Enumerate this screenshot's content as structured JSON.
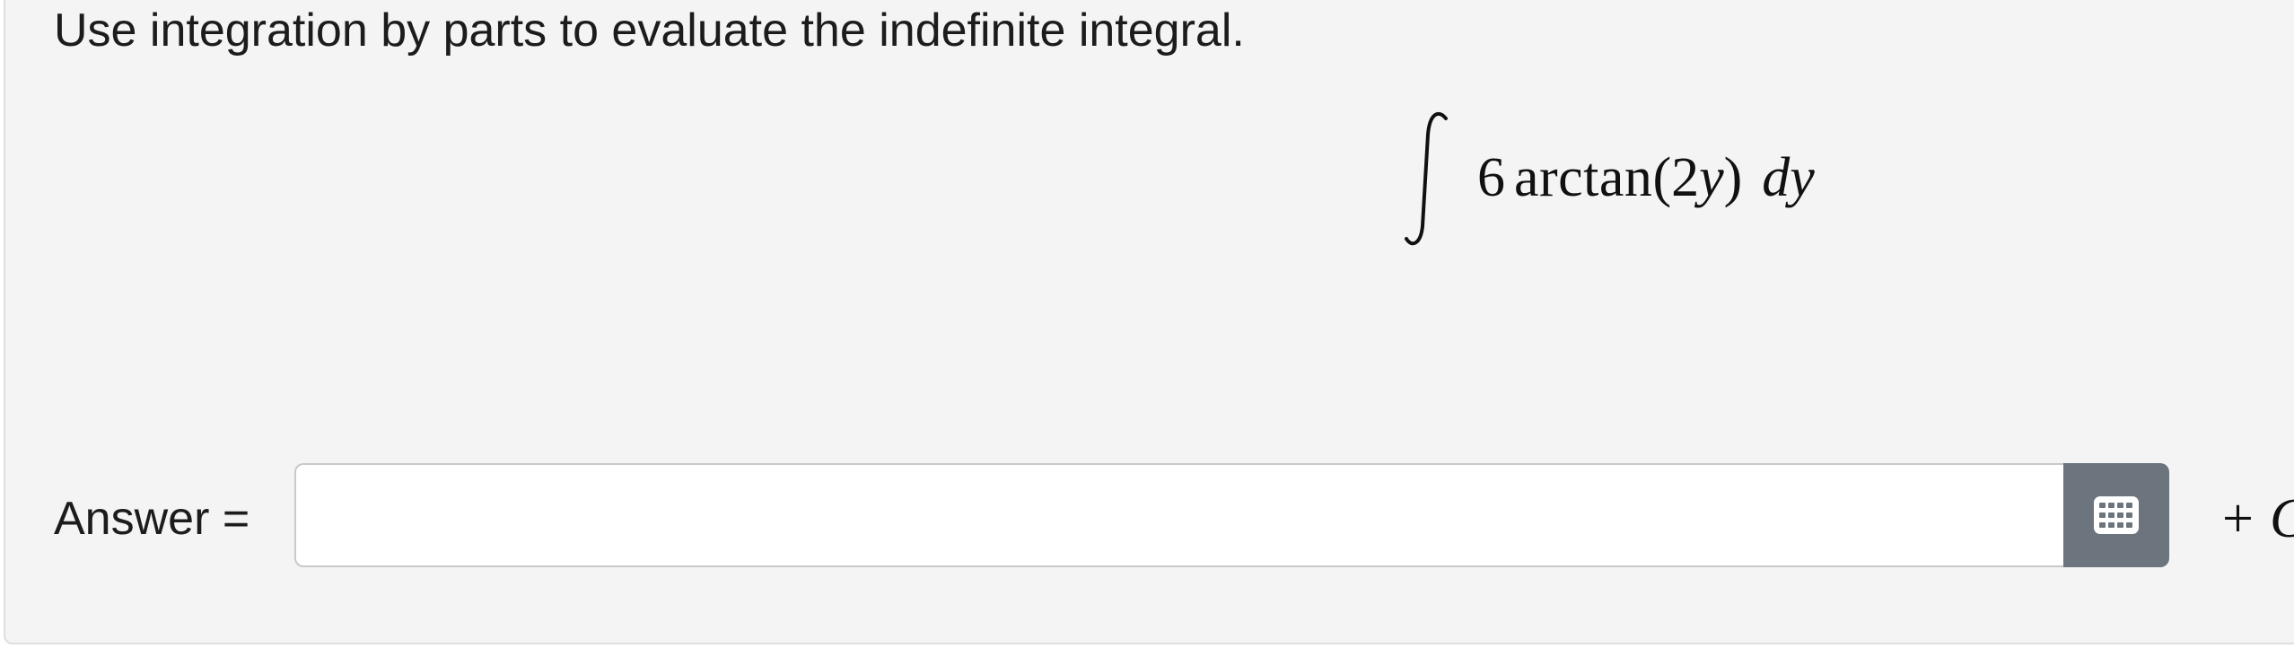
{
  "question": {
    "prompt": "Use integration by parts to evaluate the indefinite integral."
  },
  "integral": {
    "coefficient": "6",
    "function_name": "arctan",
    "open_paren": "(",
    "argument_coefficient": "2",
    "argument_variable": "y",
    "close_paren": ")",
    "differential": "dy"
  },
  "answer": {
    "label": "Answer =",
    "value": "",
    "placeholder": "",
    "keypad_icon": "keypad-icon",
    "constant_op": "+",
    "constant": "C"
  },
  "colors": {
    "card_background": "#f4f4f4",
    "keypad_button": "#6c757d"
  }
}
